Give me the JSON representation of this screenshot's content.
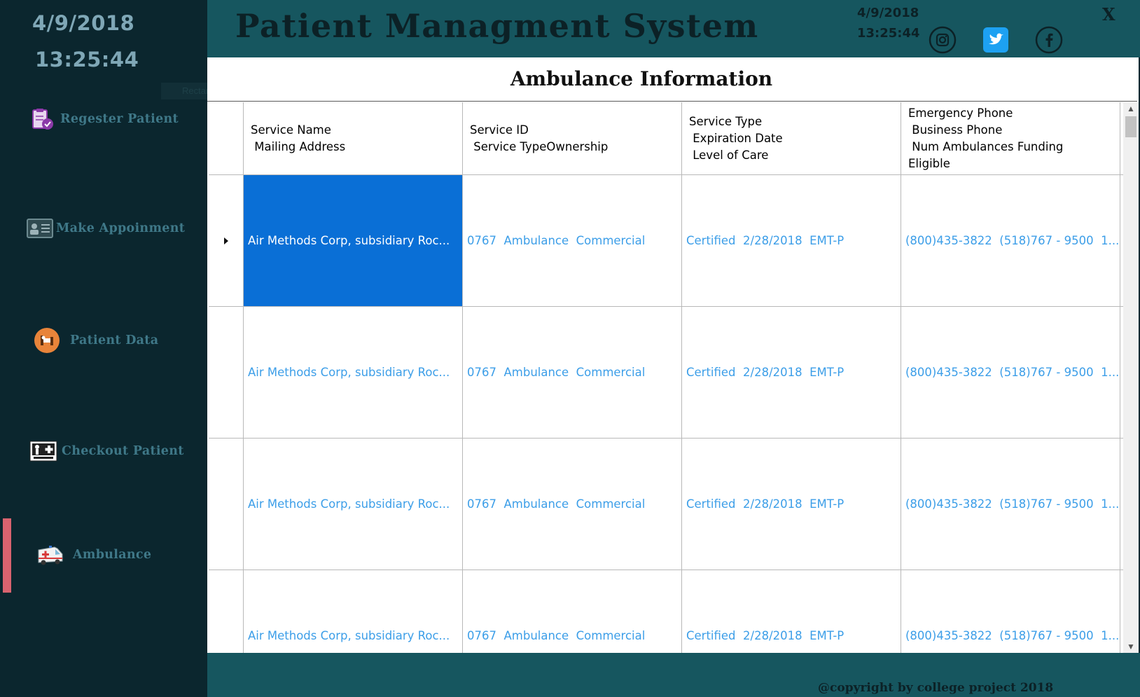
{
  "sidebar": {
    "date": "4/9/2018",
    "time": "13:25:44",
    "snip_overlay": "Rectangular Snip",
    "items": [
      {
        "label": "Regester Patient",
        "icon": "clipboard-check-icon"
      },
      {
        "label": "Make Appoinment",
        "icon": "id-card-icon"
      },
      {
        "label": "Patient Data",
        "icon": "hospital-bed-icon"
      },
      {
        "label": "Checkout Patient",
        "icon": "health-care-icon"
      },
      {
        "label": "Ambulance",
        "icon": "ambulance-icon"
      }
    ],
    "active_item": "Ambulance",
    "active_color": "#d9636f"
  },
  "header": {
    "title": "Patient Managment System",
    "date": "4/9/2018",
    "time": "13:25:44",
    "close_label": "X",
    "social": [
      "instagram-icon",
      "twitter-icon",
      "facebook-icon"
    ]
  },
  "main": {
    "section_title": "Ambulance Information",
    "columns": [
      "Service Name\n Mailing Address",
      "Service ID\n Service TypeOwnership",
      "Service Type\n Expiration Date\n Level of Care",
      "Emergency Phone\n Business Phone\n Num Ambulances Funding\nEligible"
    ],
    "rows": [
      [
        "Air Methods Corp, subsidiary Roc...",
        "0767  Ambulance  Commercial",
        "Certified  2/28/2018  EMT-P",
        "(800)435-3822  (518)767 - 9500  1..."
      ],
      [
        "Air Methods Corp, subsidiary Roc...",
        "0767  Ambulance  Commercial",
        "Certified  2/28/2018  EMT-P",
        "(800)435-3822  (518)767 - 9500  1..."
      ],
      [
        "Air Methods Corp, subsidiary Roc...",
        "0767  Ambulance  Commercial",
        "Certified  2/28/2018  EMT-P",
        "(800)435-3822  (518)767 - 9500  1..."
      ],
      [
        "Air Methods Corp, subsidiary Roc...",
        "0767  Ambulance  Commercial",
        "Certified  2/28/2018  EMT-P",
        "(800)435-3822  (518)767 - 9500  1..."
      ]
    ],
    "selected_cell_color": "#0a6fd6",
    "link_text_color": "#3c9ee8"
  },
  "footer": {
    "copyright": "@copyright by college project 2018"
  },
  "colors": {
    "sidebar_bg": "#0b262e",
    "header_bg": "#16565f",
    "content_bg": "#ffffff"
  }
}
